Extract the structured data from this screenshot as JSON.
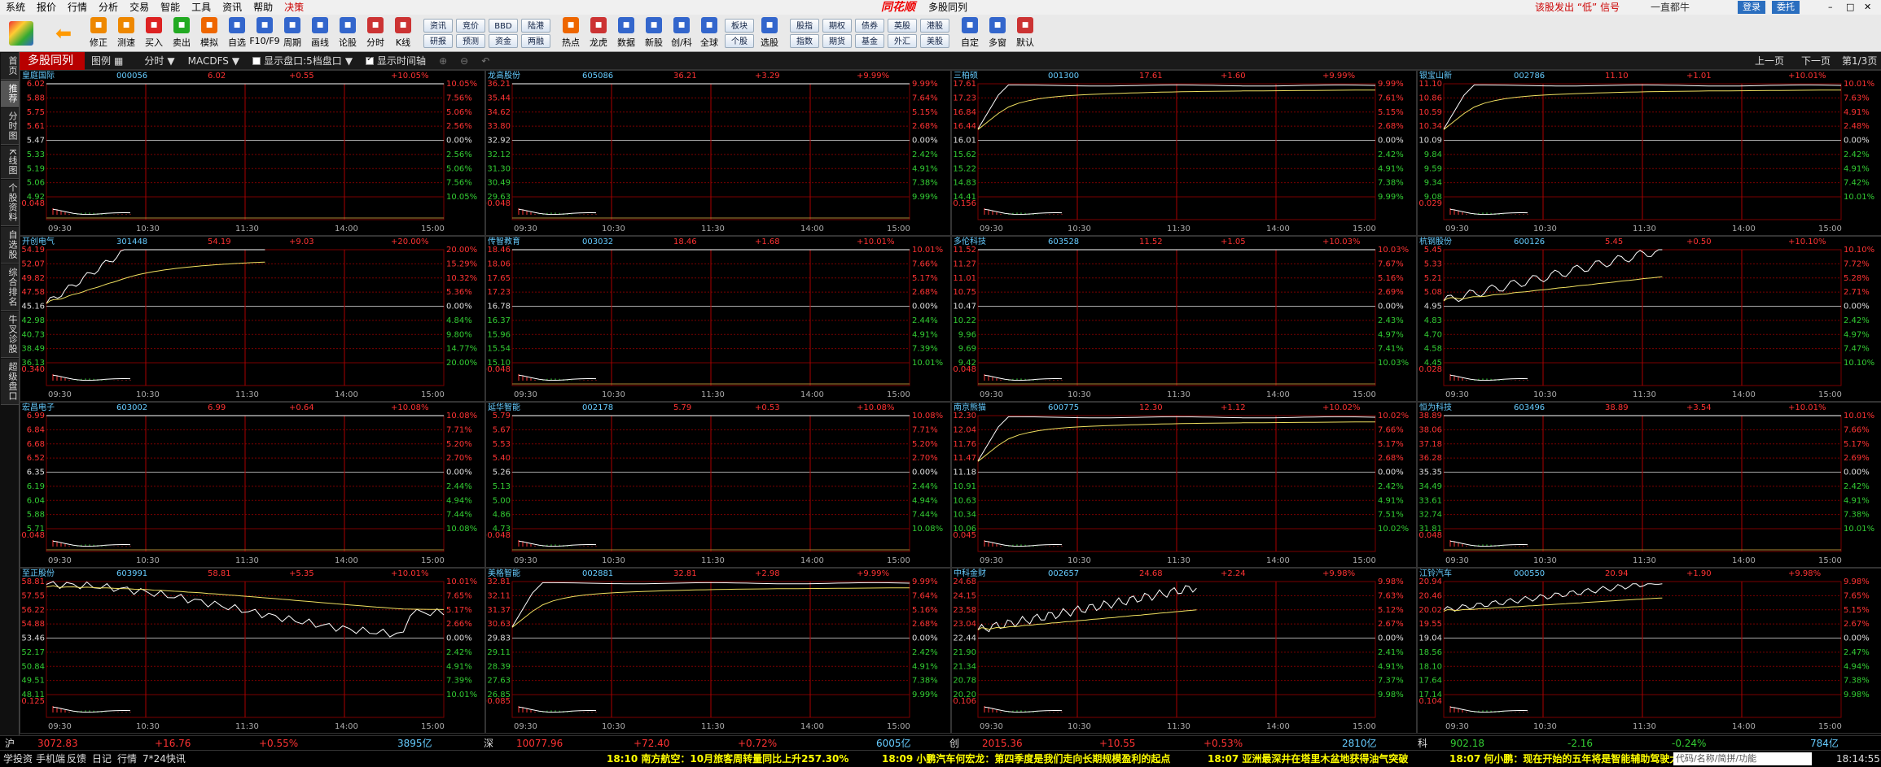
{
  "menu": [
    "系统",
    "报价",
    "行情",
    "分析",
    "交易",
    "智能",
    "工具",
    "资讯",
    "帮助",
    "决策"
  ],
  "app_logo": "同花顺",
  "window_title": "多股同列",
  "top_notice": "该股发出 “低” 信号",
  "top_news": "一直都牛",
  "top_right": {
    "login": "登录",
    "entrust": "委托"
  },
  "toolbar": {
    "btns1": [
      [
        "修正",
        "#e80"
      ],
      [
        "测速",
        "#e80"
      ],
      [
        "买入",
        "#d22"
      ],
      [
        "卖出",
        "#2a2"
      ],
      [
        "模拟",
        "#e60"
      ],
      [
        "自选",
        "#36c"
      ],
      [
        "F10/F9",
        "#36c"
      ],
      [
        "周期",
        "#36c"
      ],
      [
        "画线",
        "#36c"
      ],
      [
        "论股",
        "#36c"
      ],
      [
        "分时",
        "#c33"
      ],
      [
        "K线",
        "#c33"
      ]
    ],
    "pairs1": [
      [
        "资讯",
        "研报"
      ],
      [
        "竞价",
        "预测"
      ],
      [
        "BBD",
        "资金"
      ],
      [
        "陆港",
        "两融"
      ]
    ],
    "btns2": [
      [
        "热点",
        "#e60"
      ],
      [
        "龙虎",
        "#c33"
      ],
      [
        "数据",
        "#36c"
      ],
      [
        "新股",
        "#36c"
      ],
      [
        "创/科",
        "#36c"
      ],
      [
        "全球",
        "#36c"
      ]
    ],
    "pairs2": [
      [
        "板块",
        "个股"
      ]
    ],
    "btns3": [
      [
        "选股",
        "#36c"
      ]
    ],
    "pairs3": [
      [
        "股指",
        "指数"
      ],
      [
        "期权",
        "期货"
      ],
      [
        "债券",
        "基金"
      ],
      [
        "英股",
        "外汇"
      ],
      [
        "港股",
        "美股"
      ]
    ],
    "btns4": [
      [
        "自定",
        "#36c"
      ],
      [
        "多窗",
        "#36c"
      ],
      [
        "默认",
        "#c33"
      ]
    ]
  },
  "subbar": {
    "title": "多股同列",
    "layout": "图例",
    "period": "分时",
    "indicator": "MACDFS",
    "opt1": "显示盘口:5档盘口",
    "opt2": "显示时间轴",
    "prev": "上一页",
    "next": "下一页",
    "page": "第1/3页"
  },
  "side_tabs": [
    "首页",
    "推荐",
    "分时图",
    "K线图",
    "个股资料",
    "自选股",
    "综合排名",
    "牛叉诊股",
    "超级盘口"
  ],
  "panels": [
    {
      "name": "皇庭国际",
      "code": "000056",
      "price": "6.02",
      "chg": "+0.55",
      "pct": "+10.05%",
      "left_ticks": [
        "6.02",
        "5.88",
        "5.75",
        "5.61",
        "5.47",
        "5.33",
        "5.19",
        "5.06",
        "4.92"
      ],
      "right_ticks": [
        "10.05%",
        "7.56%",
        "5.06%",
        "2.56%",
        "0.00%",
        "2.56%",
        "5.06%",
        "7.56%",
        "10.05%"
      ],
      "vol": "+0.048",
      "shape": "flat"
    },
    {
      "name": "龙高股份",
      "code": "605086",
      "price": "36.21",
      "chg": "+3.29",
      "pct": "+9.99%",
      "left_ticks": [
        "36.21",
        "35.44",
        "34.62",
        "33.80",
        "32.92",
        "32.12",
        "31.30",
        "30.49",
        "29.63"
      ],
      "right_ticks": [
        "9.99%",
        "7.64%",
        "5.15%",
        "2.68%",
        "0.00%",
        "2.42%",
        "4.91%",
        "7.38%",
        "9.99%"
      ],
      "vol": "+0.048",
      "shape": "flat"
    },
    {
      "name": "三柏硕",
      "code": "001300",
      "price": "17.61",
      "chg": "+1.60",
      "pct": "+9.99%",
      "left_ticks": [
        "17.61",
        "17.23",
        "16.84",
        "16.44",
        "16.01",
        "15.62",
        "15.22",
        "14.83",
        "14.41"
      ],
      "right_ticks": [
        "9.99%",
        "7.61%",
        "5.15%",
        "2.68%",
        "0.00%",
        "2.42%",
        "4.91%",
        "7.38%",
        "9.99%"
      ],
      "vol": "+0.156",
      "shape": "jumpflat"
    },
    {
      "name": "银宝山新",
      "code": "002786",
      "price": "11.10",
      "chg": "+1.01",
      "pct": "+10.01%",
      "left_ticks": [
        "11.10",
        "10.86",
        "10.59",
        "10.34",
        "10.09",
        "9.84",
        "9.59",
        "9.34",
        "9.08"
      ],
      "right_ticks": [
        "10.01%",
        "7.63%",
        "4.91%",
        "2.48%",
        "0.00%",
        "2.42%",
        "4.91%",
        "7.42%",
        "10.01%"
      ],
      "vol": "+0.029",
      "shape": "jumpflat"
    },
    {
      "name": "开创电气",
      "code": "301448",
      "price": "54.19",
      "chg": "+9.03",
      "pct": "+20.00%",
      "left_ticks": [
        "54.19",
        "52.07",
        "49.82",
        "47.58",
        "45.16",
        "42.98",
        "40.73",
        "38.49",
        "36.13"
      ],
      "right_ticks": [
        "20.00%",
        "15.29%",
        "10.32%",
        "5.36%",
        "0.00%",
        "4.84%",
        "9.80%",
        "14.77%",
        "20.00%"
      ],
      "vol": "+0.340",
      "shape": "rising"
    },
    {
      "name": "传智教育",
      "code": "003032",
      "price": "18.46",
      "chg": "+1.68",
      "pct": "+10.01%",
      "left_ticks": [
        "18.46",
        "18.06",
        "17.65",
        "17.23",
        "16.78",
        "16.37",
        "15.96",
        "15.54",
        "15.10"
      ],
      "right_ticks": [
        "10.01%",
        "7.66%",
        "5.17%",
        "2.68%",
        "0.00%",
        "2.44%",
        "4.91%",
        "7.39%",
        "10.01%"
      ],
      "vol": "+0.048",
      "shape": "flat"
    },
    {
      "name": "多伦科技",
      "code": "603528",
      "price": "11.52",
      "chg": "+1.05",
      "pct": "+10.03%",
      "left_ticks": [
        "11.52",
        "11.27",
        "11.01",
        "10.75",
        "10.47",
        "10.22",
        "9.96",
        "9.69",
        "9.42"
      ],
      "right_ticks": [
        "10.03%",
        "7.67%",
        "5.16%",
        "2.69%",
        "0.00%",
        "2.43%",
        "4.97%",
        "7.41%",
        "10.03%"
      ],
      "vol": "+0.048",
      "shape": "flat"
    },
    {
      "name": "杭钢股份",
      "code": "600126",
      "price": "5.45",
      "chg": "+0.50",
      "pct": "+10.10%",
      "left_ticks": [
        "5.45",
        "5.33",
        "5.21",
        "5.08",
        "4.95",
        "4.83",
        "4.70",
        "4.58",
        "4.45"
      ],
      "right_ticks": [
        "10.10%",
        "7.72%",
        "5.28%",
        "2.71%",
        "0.00%",
        "2.42%",
        "4.97%",
        "7.47%",
        "10.10%"
      ],
      "vol": "+0.028",
      "shape": "rising2"
    },
    {
      "name": "宏昌电子",
      "code": "603002",
      "price": "6.99",
      "chg": "+0.64",
      "pct": "+10.08%",
      "left_ticks": [
        "6.99",
        "6.84",
        "6.68",
        "6.52",
        "6.35",
        "6.19",
        "6.04",
        "5.88",
        "5.71"
      ],
      "right_ticks": [
        "10.08%",
        "7.71%",
        "5.20%",
        "2.70%",
        "0.00%",
        "2.44%",
        "4.94%",
        "7.44%",
        "10.08%"
      ],
      "vol": "+0.048",
      "shape": "flat"
    },
    {
      "name": "延华智能",
      "code": "002178",
      "price": "5.79",
      "chg": "+0.53",
      "pct": "+10.08%",
      "left_ticks": [
        "5.79",
        "5.67",
        "5.53",
        "5.40",
        "5.26",
        "5.13",
        "5.00",
        "4.86",
        "4.73"
      ],
      "right_ticks": [
        "10.08%",
        "7.71%",
        "5.20%",
        "2.70%",
        "0.00%",
        "2.44%",
        "4.94%",
        "7.44%",
        "10.08%"
      ],
      "vol": "+0.048",
      "shape": "flat"
    },
    {
      "name": "南京熊猫",
      "code": "600775",
      "price": "12.30",
      "chg": "+1.12",
      "pct": "+10.02%",
      "left_ticks": [
        "12.30",
        "12.04",
        "11.76",
        "11.47",
        "11.18",
        "10.91",
        "10.63",
        "10.34",
        "10.06"
      ],
      "right_ticks": [
        "10.02%",
        "7.66%",
        "5.17%",
        "2.68%",
        "0.00%",
        "2.42%",
        "4.91%",
        "7.51%",
        "10.02%"
      ],
      "vol": "+0.045",
      "shape": "jumpflat"
    },
    {
      "name": "恒为科技",
      "code": "603496",
      "price": "38.89",
      "chg": "+3.54",
      "pct": "+10.01%",
      "left_ticks": [
        "38.89",
        "38.06",
        "37.18",
        "36.28",
        "35.35",
        "34.49",
        "33.61",
        "32.74",
        "31.81"
      ],
      "right_ticks": [
        "10.01%",
        "7.66%",
        "5.17%",
        "2.69%",
        "0.00%",
        "2.42%",
        "4.91%",
        "7.38%",
        "10.01%"
      ],
      "vol": "+0.048",
      "shape": "flat"
    },
    {
      "name": "至正股份",
      "code": "603991",
      "price": "58.81",
      "chg": "+5.35",
      "pct": "+10.01%",
      "left_ticks": [
        "58.81",
        "57.55",
        "56.22",
        "54.88",
        "53.46",
        "52.17",
        "50.84",
        "49.51",
        "48.11"
      ],
      "right_ticks": [
        "10.01%",
        "7.65%",
        "5.17%",
        "2.66%",
        "0.00%",
        "2.42%",
        "4.91%",
        "7.39%",
        "10.01%"
      ],
      "vol": "+0.125",
      "shape": "volatile"
    },
    {
      "name": "美格智能",
      "code": "002881",
      "price": "32.81",
      "chg": "+2.98",
      "pct": "+9.99%",
      "left_ticks": [
        "32.81",
        "32.11",
        "31.37",
        "30.63",
        "29.83",
        "29.11",
        "28.39",
        "27.63",
        "26.85"
      ],
      "right_ticks": [
        "9.99%",
        "7.64%",
        "5.16%",
        "2.68%",
        "0.00%",
        "2.42%",
        "4.91%",
        "7.38%",
        "9.99%"
      ],
      "vol": "+0.085",
      "shape": "jumpflat"
    },
    {
      "name": "中科金财",
      "code": "002657",
      "price": "24.68",
      "chg": "+2.24",
      "pct": "+9.98%",
      "left_ticks": [
        "24.68",
        "24.15",
        "23.58",
        "23.04",
        "22.44",
        "21.90",
        "21.34",
        "20.78",
        "20.20"
      ],
      "right_ticks": [
        "9.98%",
        "7.63%",
        "5.12%",
        "2.67%",
        "0.00%",
        "2.41%",
        "4.91%",
        "7.37%",
        "9.98%"
      ],
      "vol": "+0.106",
      "shape": "rising3"
    },
    {
      "name": "江铃汽车",
      "code": "000550",
      "price": "20.94",
      "chg": "+1.90",
      "pct": "+9.98%",
      "left_ticks": [
        "20.94",
        "20.46",
        "20.02",
        "19.55",
        "19.04",
        "18.56",
        "18.10",
        "17.64",
        "17.14"
      ],
      "right_ticks": [
        "9.98%",
        "7.65%",
        "5.15%",
        "2.67%",
        "0.00%",
        "2.47%",
        "4.94%",
        "7.38%",
        "9.98%"
      ],
      "vol": "+0.104",
      "shape": "rising4"
    }
  ],
  "time_ticks": [
    "09:30",
    "10:30",
    "11:30",
    "14:00",
    "15:00"
  ],
  "indices": [
    {
      "label": "沪",
      "val": "3072.83",
      "chg": "+16.76",
      "pct": "+0.55%",
      "amt": "3895亿"
    },
    {
      "label": "深",
      "val": "10077.96",
      "chg": "+72.40",
      "pct": "+0.72%",
      "amt": "6005亿"
    },
    {
      "label": "创",
      "val": "2015.36",
      "chg": "+10.55",
      "pct": "+0.53%",
      "amt": "2810亿"
    },
    {
      "label": "科",
      "val": "902.18",
      "chg": "-2.16",
      "pct": "-0.24%",
      "amt": "784亿"
    }
  ],
  "ticker_left": [
    "学投资",
    "手机端",
    "反馈",
    "日记",
    "行情",
    "7*24快讯"
  ],
  "news": [
    "18:10 南方航空：10月旅客周转量同比上升257.30%",
    "18:09 小鹏汽车何宏龙：第四季度是我们走向长期规模盈利的起点",
    "18:07 亚洲最深井在塔里木盆地获得油气突破",
    "18:07 何小鹏：现在开始的五年将是智能辅助驾驶大爆发"
  ],
  "search_placeholder": "代码/名称/简拼/功能",
  "clock": "18:14:55",
  "colors": {
    "up": "#ff3333",
    "down": "#33cc33",
    "accent": "#b80000",
    "grid": "#7a0000"
  }
}
